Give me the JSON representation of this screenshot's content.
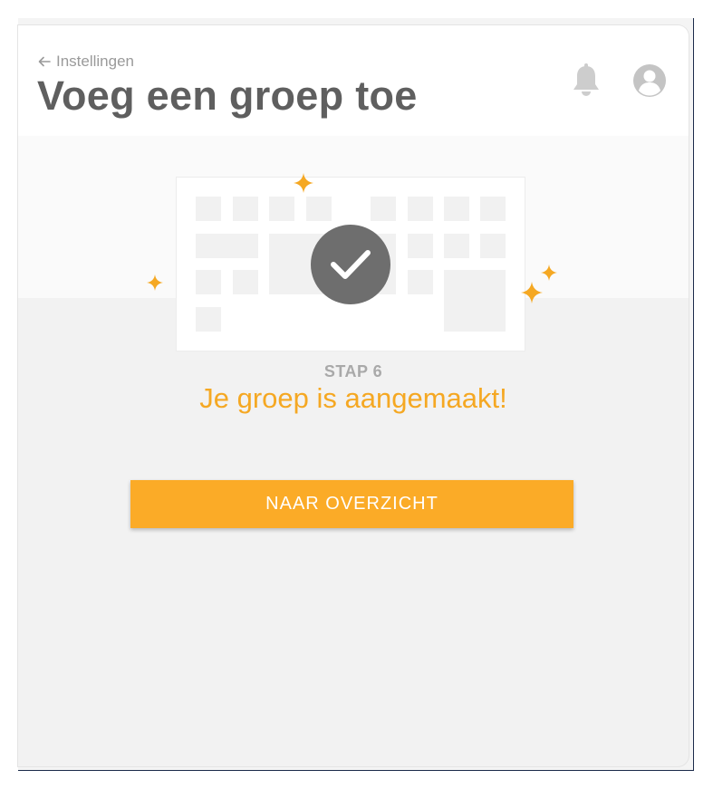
{
  "header": {
    "back_label": "Instellingen",
    "title": "Voeg een groep toe"
  },
  "icons": {
    "back": "arrow-left-icon",
    "notifications": "bell-icon",
    "profile": "user-avatar-icon",
    "success": "checkmark-icon",
    "decoration": "sparkle-icon"
  },
  "wizard": {
    "step_label": "STAP 6",
    "message": "Je groep is aangemaakt!",
    "button_label": "NAAR OVERZICHT"
  },
  "colors": {
    "accent": "#fbab27",
    "message": "#f5a823",
    "title": "#5f5f5f",
    "badge": "#6e6e6e"
  }
}
